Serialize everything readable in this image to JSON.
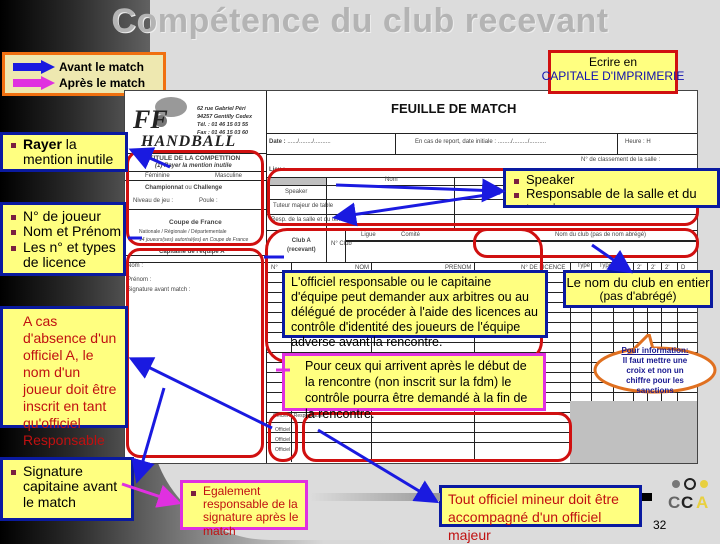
{
  "slide": {
    "title": "Compétence du club recevant",
    "page_number": "32"
  },
  "legend": {
    "items": [
      {
        "label": "Avant le match",
        "color": "#1a1ae0"
      },
      {
        "label": "Après le match",
        "color": "#e030e0"
      }
    ]
  },
  "callouts": {
    "capitale": {
      "line1": "Ecrire en",
      "line2": "CAPITALE D'IMPRIMERIE"
    },
    "rayer": {
      "bold": "Rayer",
      "rest": " la mention inutile"
    },
    "joueur": {
      "items": [
        "N° de joueur",
        "Nom et Prénom",
        "Les n° et types de licence"
      ]
    },
    "absence": {
      "text": "A cas d'absence d'un officiel A, le nom d'un joueur doit être inscrit en tant qu'officiel Responsable"
    },
    "signature": {
      "items": [
        "Signature capitaine avant le match"
      ]
    },
    "egalement": {
      "items": [
        "Egalement responsable de la signature après le match"
      ]
    },
    "speaker": {
      "items": [
        "Speaker",
        "Responsable de la salle et du terrain"
      ]
    },
    "controle": {
      "text": "L'officiel responsable ou le capitaine d'équipe peut demander aux arbitres ou au délégué de procéder à l'aide des licences au contrôle d'identité des joueurs de l'équipe adverse avant la rencontre."
    },
    "club_nom": {
      "text": "Le nom du club en entier",
      "sub": "(pas d'abrégé)"
    },
    "info": {
      "title": "Pour information:",
      "text": "Il faut mettre une croix et non un chiffre pour les sanctions"
    },
    "retard": {
      "text": "Pour ceux qui arrivent après le début de la rencontre (non inscrit sur la fdm) le contrôle pourra être demandé à la fin de la rencontre."
    },
    "mineur": {
      "text": "Tout officiel mineur doit être accompagné d'un officiel majeur"
    }
  },
  "sheet": {
    "logo": {
      "line1": "FF",
      "line2": "HANDBALL"
    },
    "address": [
      "62 rue Gabriel Péri",
      "94257 Gentilly Cedex",
      "Tél. : 01 46 15 03 55",
      "Fax : 01 46 15 03 60"
    ],
    "heading": "FEUILLE DE MATCH",
    "competition_title": "INTITULE DE LA COMPETITION",
    "rayer_note": "(1) Rayer la mention inutile",
    "feminine": "Féminine",
    "masculine": "Masculine",
    "championnat": "Championnat",
    "ou": "ou",
    "challenge": "Challenge",
    "niveau": "Niveau de jeu :",
    "poule": "Poule :",
    "coupe": "Coupe de France",
    "coupe_levels": "Nationale / Régionale / Départementale",
    "coupe_note": "14 joueurs(ses) autorisé(es) en Coupe de France",
    "capitaine_title": "Capitaine de l'équipe A",
    "nom_label": "Nom :",
    "prenom_label": "Prénom :",
    "signature_label": "Signature avant match :",
    "date_label": "Date :",
    "date_value": "....../......../..........",
    "report_label": "En cas de report, date initiale :",
    "report_value": "......../........./..........",
    "heure_label": "Heure :",
    "heure_value": "H",
    "lieu_label": "Lieu :",
    "classement_label": "N° de classement de la salle :",
    "nom_col": "Nom",
    "speaker_row": "Speaker",
    "tuteur_row": "Tuteur majeur de table",
    "resp_row": "Resp. de la salle et du terrain",
    "club_a": "Club A",
    "recevant": "(recevant)",
    "n_club": "N° Club",
    "ligue": "Ligue",
    "comite": "Comité",
    "nom_club_header": "Nom du club (pas de nom abrégé)",
    "cols": [
      "N°",
      "NOM",
      "PRENOM",
      "N° DE LICENCE",
      "Type",
      "Type",
      "Av.",
      "2'",
      "2'",
      "2'",
      "D"
    ],
    "officials": [
      "Officiel A Responsable",
      "Officiel",
      "Officiel",
      "Officiel"
    ]
  }
}
